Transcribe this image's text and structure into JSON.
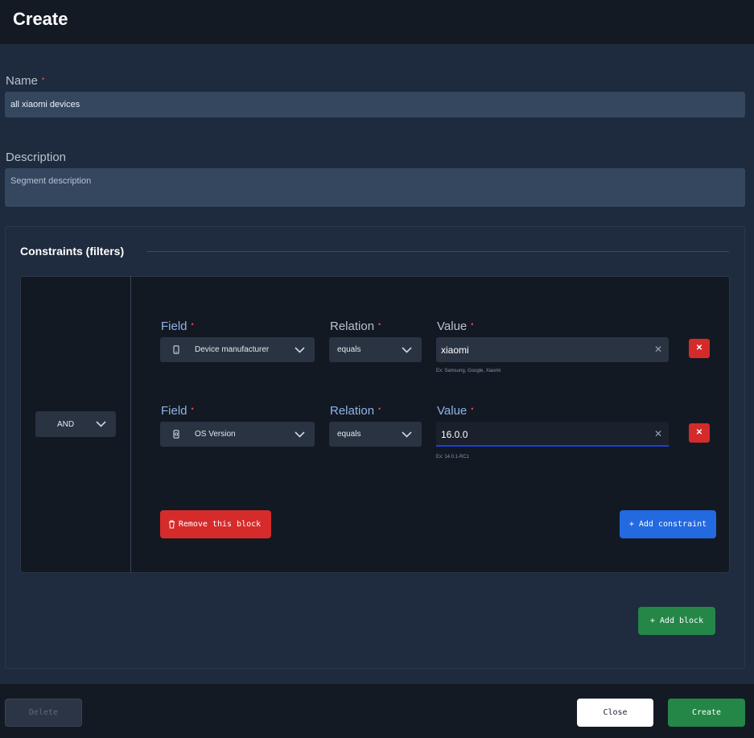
{
  "header": {
    "title": "Create"
  },
  "form": {
    "name_label": "Name",
    "required_mark": "•",
    "name_value": "all xiaomi devices",
    "description_label": "Description",
    "description_placeholder": "Segment description"
  },
  "constraints": {
    "title": "Constraints (filters)",
    "operator": "AND",
    "rows": [
      {
        "field_label": "Field",
        "field_value": "Device manufacturer",
        "field_icon": "smartphone-icon",
        "relation_label": "Relation",
        "relation_value": "equals",
        "value_label": "Value",
        "value": "xiaomi",
        "hint": "Ex: Samsung, Google, Xiaomi",
        "clear_glyph": "✕",
        "delete_glyph": "✕"
      },
      {
        "field_label": "Field",
        "field_value": "OS Version",
        "field_icon": "device-settings-icon",
        "relation_label": "Relation",
        "relation_value": "equals",
        "value_label": "Value",
        "value": "16.0.0",
        "hint": "Ex: 14.0.1-RC1",
        "clear_glyph": "✕",
        "delete_glyph": "✕"
      }
    ],
    "remove_block_label": "Remove this block",
    "add_constraint_label": "+ Add constraint",
    "add_block_label": "+ Add block"
  },
  "footer": {
    "delete_label": "Delete",
    "close_label": "Close",
    "create_label": "Create"
  },
  "colors": {
    "background": "#1e2a3d",
    "header": "#131a24",
    "danger": "#d62b2b",
    "primary": "#2369e0",
    "success": "#248647",
    "required": "#e5484d"
  }
}
